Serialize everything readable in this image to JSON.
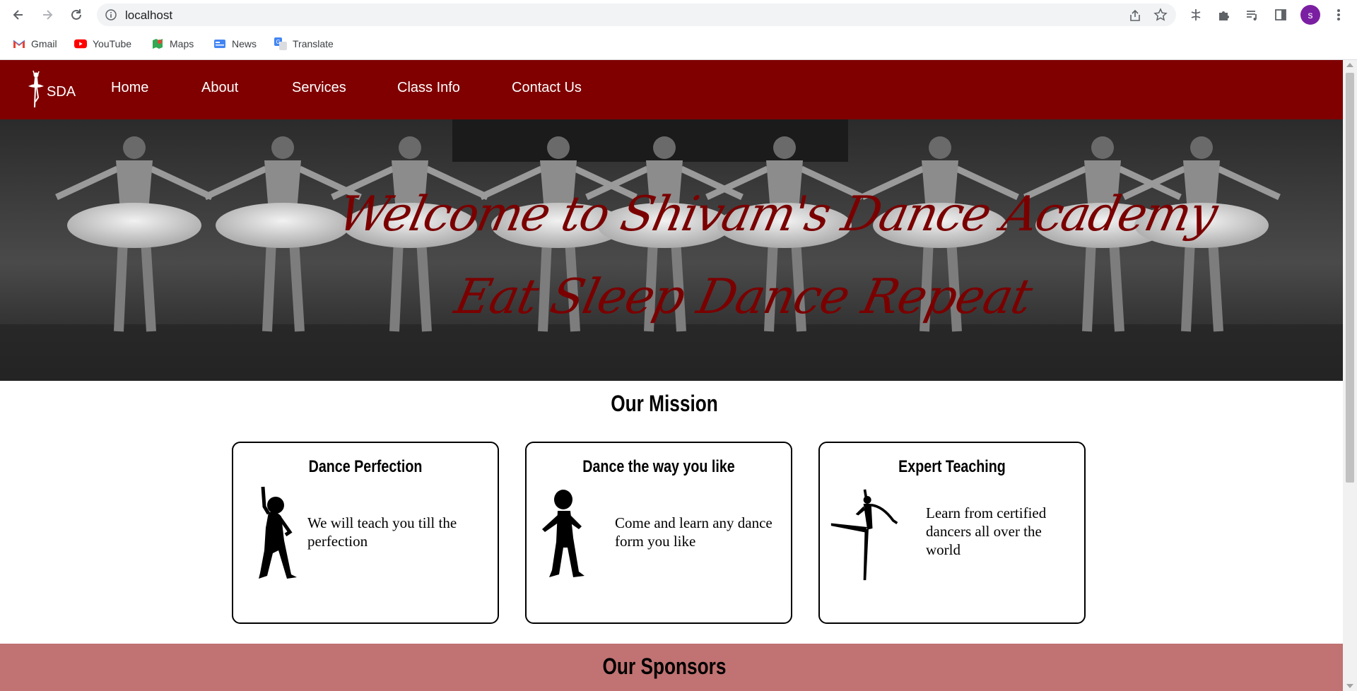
{
  "browser": {
    "url": "localhost",
    "avatar_letter": "s",
    "bookmarks": [
      {
        "label": "Gmail",
        "icon": "gmail-icon"
      },
      {
        "label": "YouTube",
        "icon": "youtube-icon"
      },
      {
        "label": "Maps",
        "icon": "maps-icon"
      },
      {
        "label": "News",
        "icon": "news-icon"
      },
      {
        "label": "Translate",
        "icon": "translate-icon"
      }
    ]
  },
  "site": {
    "logo_text": "SDA",
    "nav": [
      "Home",
      "About",
      "Services",
      "Class Info",
      "Contact Us"
    ],
    "hero_title": "Welcome to Shivam's Dance Academy",
    "hero_subtitle": "Eat Sleep Dance Repeat",
    "mission_heading": "Our Mission",
    "cards": [
      {
        "title": "Dance Perfection",
        "text": "We will teach you till the perfection"
      },
      {
        "title": "Dance the way you like",
        "text": "Come and learn any dance form you like"
      },
      {
        "title": "Expert Teaching",
        "text": "Learn from certified dancers all over the world"
      }
    ],
    "sponsors_heading": "Our Sponsors"
  },
  "colors": {
    "nav_bg": "#800000",
    "hero_text": "#7a0000",
    "sponsors_bg": "#c17272"
  }
}
